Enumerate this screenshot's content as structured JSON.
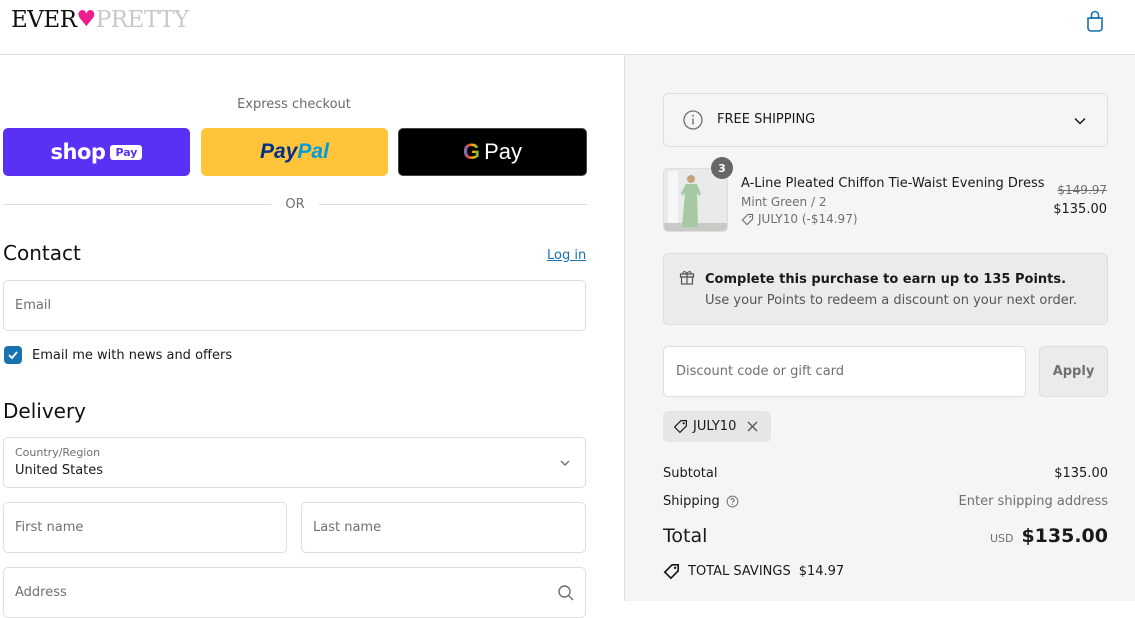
{
  "header": {
    "logo_left": "EVER",
    "logo_heart": "♥",
    "logo_right": "PRETTY",
    "cart_icon": "shopping-bag-icon"
  },
  "express": {
    "label": "Express checkout",
    "shop_pay": {
      "word": "shop",
      "chip": "Pay"
    },
    "paypal": {
      "part1": "Pay",
      "part2": "Pal"
    },
    "gpay": {
      "g": "G",
      "pay": "Pay"
    },
    "or_label": "OR"
  },
  "contact": {
    "title": "Contact",
    "login_link": "Log in",
    "email_placeholder": "Email",
    "newsletter_label": "Email me with news and offers",
    "newsletter_checked": true
  },
  "delivery": {
    "title": "Delivery",
    "country_label": "Country/Region",
    "country_value": "United States",
    "first_name_placeholder": "First name",
    "last_name_placeholder": "Last name",
    "address_placeholder": "Address"
  },
  "summary": {
    "shipping_banner": "FREE SHIPPING",
    "item": {
      "quantity": "3",
      "name": "A-Line Pleated Chiffon Tie-Waist Evening Dress",
      "variant": "Mint Green / 2",
      "discount": "JULY10 (-$14.97)",
      "original_price": "$149.97",
      "price": "$135.00"
    },
    "points": {
      "headline": "Complete this purchase to earn up to 135 Points.",
      "subtext": "Use your Points to redeem a discount on your next order."
    },
    "discount_placeholder": "Discount code or gift card",
    "apply_label": "Apply",
    "applied_code": "JULY10",
    "subtotal_label": "Subtotal",
    "subtotal_value": "$135.00",
    "shipping_label": "Shipping",
    "shipping_value": "Enter shipping address",
    "total_label": "Total",
    "currency": "USD",
    "total_value": "$135.00",
    "savings_label": "TOTAL SAVINGS",
    "savings_value": "$14.97"
  },
  "colors": {
    "accent": "#1773b0",
    "shop_pay": "#5a31f4",
    "paypal": "#ffc439",
    "logo_heart": "#ee1c8f"
  }
}
